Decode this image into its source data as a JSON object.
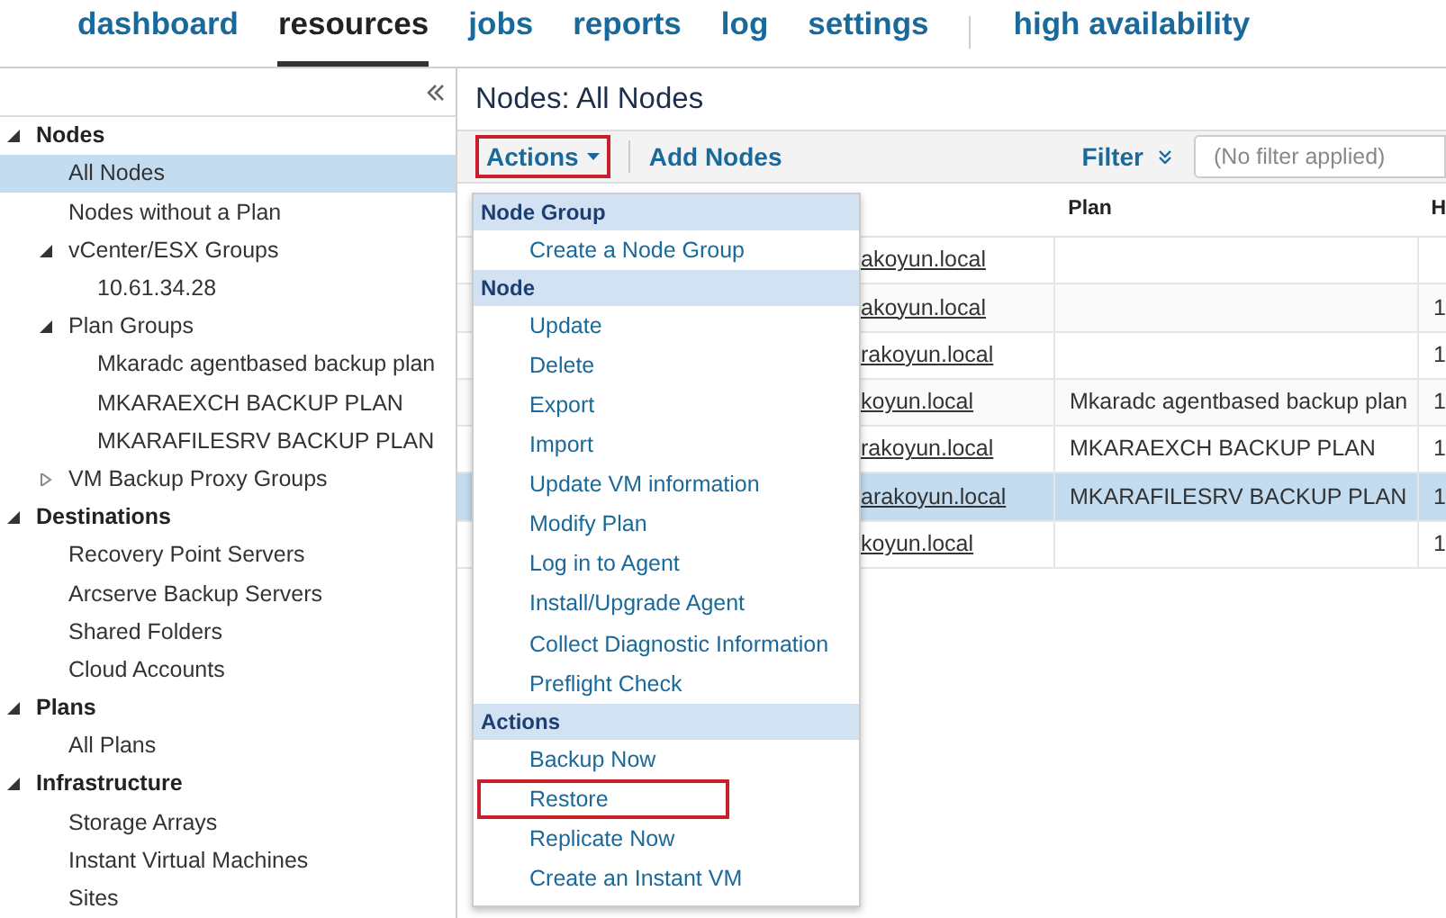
{
  "nav_tabs": [
    {
      "label": "dashboard",
      "selected": false
    },
    {
      "label": "resources",
      "selected": true
    },
    {
      "label": "jobs",
      "selected": false
    },
    {
      "label": "reports",
      "selected": false
    },
    {
      "label": "log",
      "selected": false
    },
    {
      "label": "settings",
      "selected": false
    },
    {
      "label": "high availability",
      "selected": false
    }
  ],
  "sidebar": {
    "items": [
      {
        "label": "Nodes",
        "kind": "category",
        "expanded": true,
        "selected": false,
        "children": [
          {
            "label": "All Nodes",
            "selected": true
          },
          {
            "label": "Nodes without a Plan",
            "selected": false
          },
          {
            "label": "vCenter/ESX Groups",
            "expanded": true,
            "selected": false,
            "children": [
              {
                "label": "10.61.34.28",
                "selected": false
              }
            ]
          },
          {
            "label": "Plan Groups",
            "expanded": true,
            "selected": false,
            "children": [
              {
                "label": "Mkaradc agentbased backup plan",
                "selected": false
              },
              {
                "label": "MKARAEXCH BACKUP PLAN",
                "selected": false
              },
              {
                "label": "MKARAFILESRV BACKUP PLAN",
                "selected": false
              }
            ]
          },
          {
            "label": "VM Backup Proxy Groups",
            "expanded": false,
            "selected": false
          }
        ]
      },
      {
        "label": "Destinations",
        "kind": "category",
        "expanded": true,
        "selected": false,
        "children": [
          {
            "label": "Recovery Point Servers",
            "selected": false
          },
          {
            "label": "Arcserve Backup Servers",
            "selected": false
          },
          {
            "label": "Shared Folders",
            "selected": false
          },
          {
            "label": "Cloud Accounts",
            "selected": false
          }
        ]
      },
      {
        "label": "Plans",
        "kind": "category",
        "expanded": true,
        "selected": false,
        "children": [
          {
            "label": "All Plans",
            "selected": false
          }
        ]
      },
      {
        "label": "Infrastructure",
        "kind": "category",
        "expanded": true,
        "selected": false,
        "children": [
          {
            "label": "Storage Arrays",
            "selected": false
          },
          {
            "label": "Instant Virtual Machines",
            "selected": false
          },
          {
            "label": "Sites",
            "selected": false
          }
        ]
      }
    ]
  },
  "main": {
    "title": "Nodes: All Nodes",
    "toolbar": {
      "actions": {
        "label": "Actions",
        "highlighted": true
      },
      "add_nodes": "Add Nodes",
      "filter": "Filter",
      "filter_field": {
        "placeholder": "(No filter applied)"
      }
    },
    "table": {
      "columns": [
        "Plan",
        "H"
      ],
      "rows": [
        {
          "name": "akoyun.local",
          "plan": "",
          "column_3": "",
          "selected": false
        },
        {
          "name": "akoyun.local",
          "plan": "",
          "column_3": "1",
          "selected": false
        },
        {
          "name": "rakoyun.local",
          "plan": "",
          "column_3": "1",
          "selected": false
        },
        {
          "name": "koyun.local",
          "plan": "Mkaradc agentbased backup plan",
          "column_3": "1",
          "selected": false
        },
        {
          "name": "rakoyun.local",
          "plan": "MKARAEXCH BACKUP PLAN",
          "column_3": "1",
          "selected": false
        },
        {
          "name": "arakoyun.local",
          "plan": "MKARAFILESRV BACKUP PLAN",
          "column_3": "1",
          "selected": true
        },
        {
          "name": "koyun.local",
          "plan": "",
          "column_3": "1",
          "selected": false
        }
      ]
    },
    "actions_menu": [
      {
        "header": "Node Group",
        "items": [
          {
            "label": "Create a Node Group",
            "highlighted": false
          }
        ]
      },
      {
        "header": "Node",
        "items": [
          {
            "label": "Update",
            "highlighted": false
          },
          {
            "label": "Delete",
            "highlighted": false
          },
          {
            "label": "Export",
            "highlighted": false
          },
          {
            "label": "Import",
            "highlighted": false
          },
          {
            "label": "Update VM information",
            "highlighted": false
          },
          {
            "label": "Modify Plan",
            "highlighted": false
          },
          {
            "label": "Log in to Agent",
            "highlighted": false
          },
          {
            "label": "Install/Upgrade Agent",
            "highlighted": false
          },
          {
            "label": "Collect Diagnostic Information",
            "highlighted": false
          },
          {
            "label": "Preflight Check",
            "highlighted": false
          }
        ]
      },
      {
        "header": "Actions",
        "items": [
          {
            "label": "Backup Now",
            "highlighted": false
          },
          {
            "label": "Restore",
            "highlighted": true
          },
          {
            "label": "Replicate Now",
            "highlighted": false
          },
          {
            "label": "Create an Instant VM",
            "highlighted": false
          }
        ]
      }
    ]
  }
}
